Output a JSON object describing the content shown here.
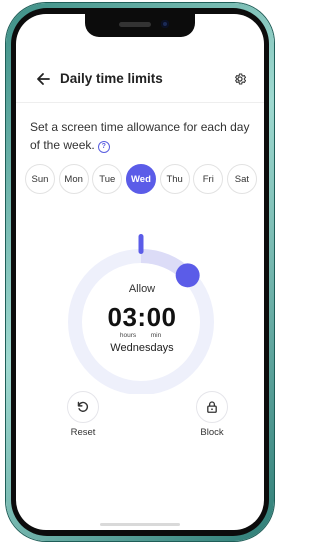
{
  "header": {
    "title": "Daily time limits",
    "back_icon": "arrow-left-icon",
    "settings_icon": "gear-icon"
  },
  "description": {
    "text": "Set a screen time allowance for each day of the week.",
    "help_icon": "question-icon"
  },
  "days": [
    {
      "label": "Sun",
      "selected": false
    },
    {
      "label": "Mon",
      "selected": false
    },
    {
      "label": "Tue",
      "selected": false
    },
    {
      "label": "Wed",
      "selected": true
    },
    {
      "label": "Thu",
      "selected": false
    },
    {
      "label": "Fri",
      "selected": false
    },
    {
      "label": "Sat",
      "selected": false
    }
  ],
  "dial": {
    "label": "Allow",
    "time": "03:00",
    "unit_hours": "hours",
    "unit_min": "min",
    "day": "Wednesdays",
    "progress_fraction": 0.125
  },
  "actions": {
    "reset": {
      "label": "Reset",
      "icon": "reset-icon"
    },
    "block": {
      "label": "Block",
      "icon": "lock-icon"
    }
  },
  "colors": {
    "accent": "#5b5ce8",
    "track": "#eef0fb",
    "phone_frame": "#6bbcb2"
  }
}
